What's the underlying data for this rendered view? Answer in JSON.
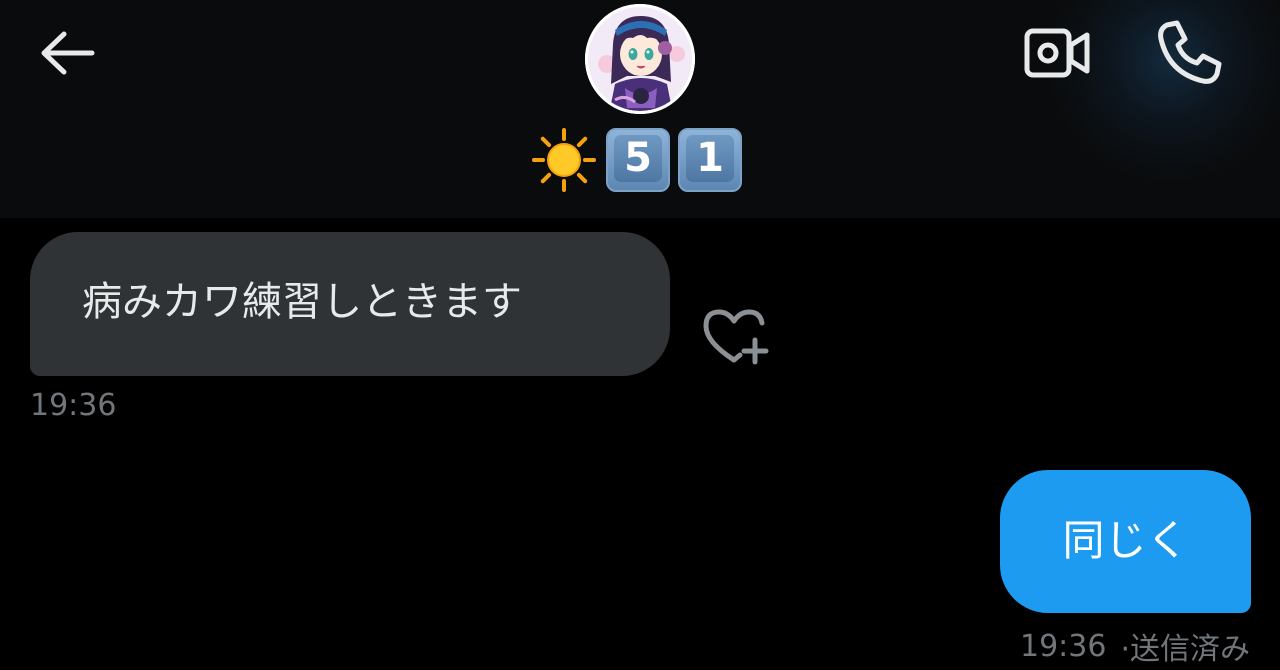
{
  "header": {
    "back_icon": "arrow-left-icon",
    "avatar_icon": "profile-avatar",
    "display_name_emoji": [
      "sun-emoji",
      "keycap-5-emoji",
      "keycap-1-emoji"
    ],
    "display_name_digits": [
      "5",
      "1"
    ],
    "video_icon": "video-camera-icon",
    "phone_icon": "phone-icon"
  },
  "messages": [
    {
      "direction": "incoming",
      "text": "病みカワ練習しときます",
      "time": "19:36",
      "reaction_icon": "heart-plus-icon"
    },
    {
      "direction": "outgoing",
      "text": "同じく",
      "time": "19:36",
      "separator": "·",
      "status": "送信済み"
    }
  ],
  "colors": {
    "background": "#000000",
    "header_background": "#0a0b0c",
    "incoming_bubble": "#2f3336",
    "outgoing_bubble": "#1d9bf0",
    "timestamp": "#71767b",
    "text": "#e7e9ea"
  }
}
